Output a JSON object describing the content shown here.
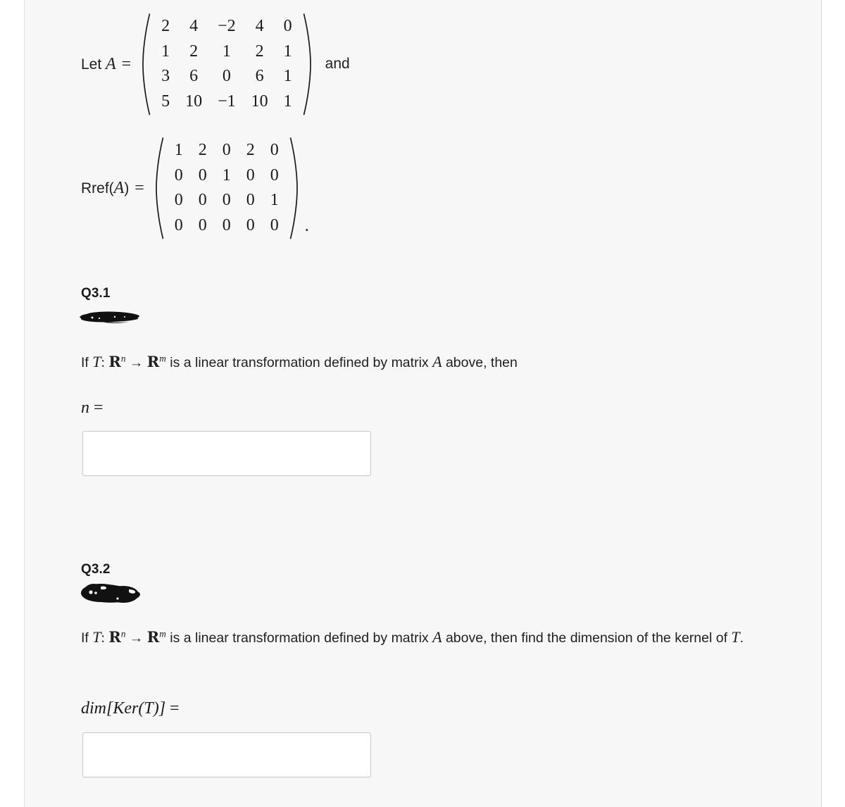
{
  "document": {
    "background_color": "#f7f7f7",
    "text_color": "#1f1f1f"
  },
  "matrix_a": {
    "label_prefix": "Let",
    "label_symbol": "A",
    "equals": "=",
    "trailing_text": "and",
    "rows": [
      [
        "2",
        "4",
        "−2",
        "4",
        "0"
      ],
      [
        "1",
        "2",
        "1",
        "2",
        "1"
      ],
      [
        "3",
        "6",
        "0",
        "6",
        "1"
      ],
      [
        "5",
        "10",
        "−1",
        "10",
        "1"
      ]
    ]
  },
  "matrix_rref": {
    "label": "Rref(",
    "label_symbol": "A",
    "label_suffix": ")",
    "equals": "=",
    "trailing_punctuation": ".",
    "rows": [
      [
        "1",
        "2",
        "0",
        "2",
        "0"
      ],
      [
        "0",
        "0",
        "1",
        "0",
        "0"
      ],
      [
        "0",
        "0",
        "0",
        "0",
        "1"
      ],
      [
        "0",
        "0",
        "0",
        "0",
        "0"
      ]
    ]
  },
  "questions": [
    {
      "heading": "Q3.1",
      "redacted": true,
      "prompt_parts": {
        "a": "If",
        "t": "T",
        "colon": ":",
        "domain": "R",
        "domain_exp": "n",
        "arrow": "→",
        "codomain": "R",
        "codomain_exp": "m",
        "b": "is a linear transformation defined by matrix",
        "matrix_symbol": "A",
        "c": "above, then"
      },
      "answer_label": {
        "symbol": "n",
        "equals": "="
      },
      "answer_value": "",
      "answer_placeholder": ""
    },
    {
      "heading": "Q3.2",
      "redacted": true,
      "prompt_parts": {
        "a": "If",
        "t": "T",
        "colon": ":",
        "domain": "R",
        "domain_exp": "n",
        "arrow": "→",
        "codomain": "R",
        "codomain_exp": "m",
        "b": "is a linear transformation defined by matrix",
        "matrix_symbol": "A",
        "c": "above, then find the",
        "line2": "dimension of the kernel of",
        "t2": "T",
        "period": "."
      },
      "answer_label": {
        "dim": "dim",
        "open": "[",
        "ker": "Ker",
        "paren_open": "(",
        "t": "T",
        "paren_close": ")",
        "close": "]",
        "equals": "="
      },
      "answer_value": "",
      "answer_placeholder": ""
    }
  ]
}
